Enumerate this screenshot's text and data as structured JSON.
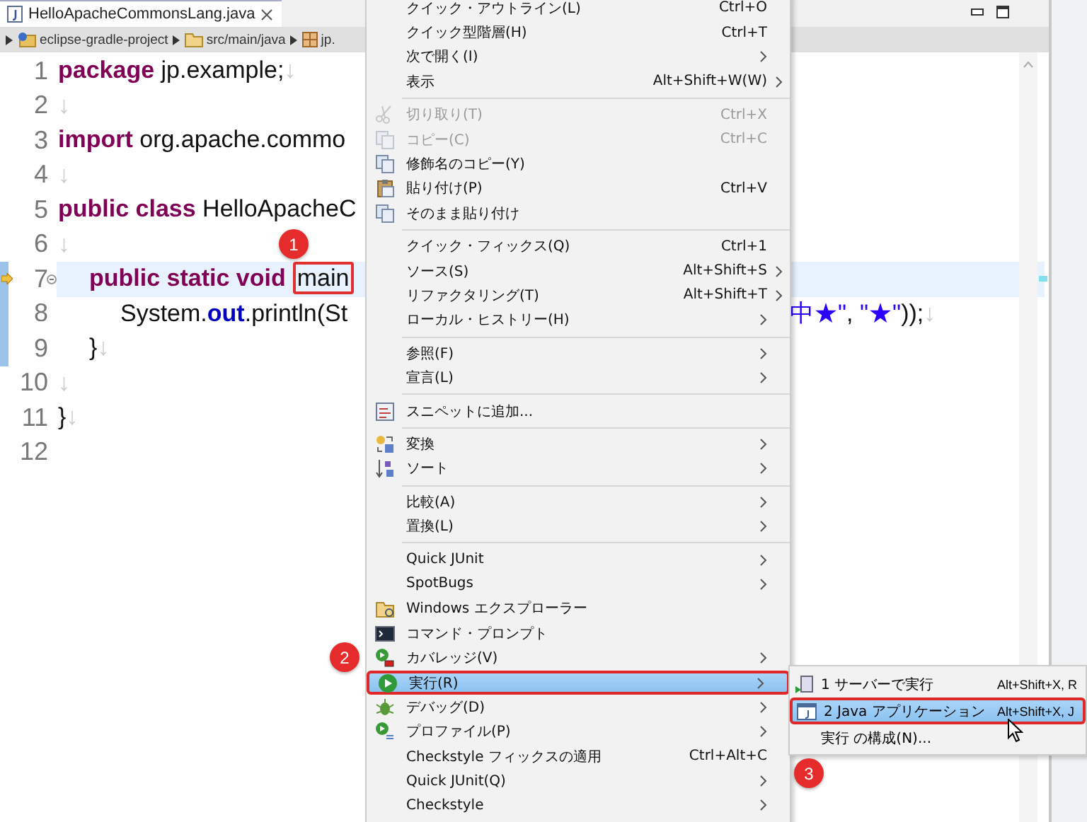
{
  "editor": {
    "tab": {
      "title": "HelloApacheCommonsLang.java",
      "selected": true
    },
    "breadcrumb": [
      "eclipse-gradle-project",
      "src/main/java",
      "jp."
    ],
    "lines": [
      {
        "number": "1",
        "changed": false,
        "current": false,
        "foldable": false,
        "segments": [
          {
            "kind": "keyword",
            "text": "package"
          },
          {
            "kind": "plain",
            "text": " jp.example;"
          },
          {
            "kind": "eol",
            "text": "↓"
          }
        ]
      },
      {
        "number": "2",
        "changed": false,
        "current": false,
        "foldable": false,
        "segments": [
          {
            "kind": "eol",
            "text": "↓"
          }
        ]
      },
      {
        "number": "3",
        "changed": false,
        "current": false,
        "foldable": false,
        "segments": [
          {
            "kind": "keyword",
            "text": "import"
          },
          {
            "kind": "plain",
            "text": " org.apache.commo"
          }
        ]
      },
      {
        "number": "4",
        "changed": false,
        "current": false,
        "foldable": false,
        "segments": [
          {
            "kind": "eol",
            "text": "↓"
          }
        ]
      },
      {
        "number": "5",
        "changed": false,
        "current": false,
        "foldable": false,
        "segments": [
          {
            "kind": "keyword",
            "text": "public class"
          },
          {
            "kind": "plain",
            "text": " HelloApacheC"
          }
        ]
      },
      {
        "number": "6",
        "changed": false,
        "current": false,
        "foldable": false,
        "segments": [
          {
            "kind": "eol",
            "text": "↓"
          }
        ]
      },
      {
        "number": "7",
        "changed": true,
        "current": true,
        "foldable": true,
        "segments": [
          {
            "kind": "keyword",
            "text": "\tpublic static void"
          },
          {
            "kind": "boxed",
            "text": "main"
          }
        ]
      },
      {
        "number": "8",
        "changed": true,
        "current": false,
        "foldable": false,
        "segments": [
          {
            "kind": "plain",
            "text": "\t\tSystem."
          },
          {
            "kind": "field",
            "text": "out"
          },
          {
            "kind": "plain",
            "text": ".println(St"
          }
        ],
        "tail": [
          {
            "kind": "string",
            "text": "中★\""
          },
          {
            "kind": "plain",
            "text": ", "
          },
          {
            "kind": "string",
            "text": "\"★\""
          },
          {
            "kind": "plain",
            "text": "));"
          },
          {
            "kind": "eol",
            "text": "↓"
          }
        ]
      },
      {
        "number": "9",
        "changed": true,
        "current": false,
        "foldable": false,
        "segments": [
          {
            "kind": "plain",
            "text": "\t}"
          },
          {
            "kind": "eol",
            "text": "↓"
          }
        ]
      },
      {
        "number": "10",
        "changed": false,
        "current": false,
        "foldable": false,
        "segments": [
          {
            "kind": "eol",
            "text": "↓"
          }
        ]
      },
      {
        "number": "11",
        "changed": false,
        "current": false,
        "foldable": false,
        "segments": [
          {
            "kind": "plain",
            "text": "}"
          },
          {
            "kind": "eol",
            "text": "↓"
          }
        ]
      },
      {
        "number": "12",
        "changed": false,
        "current": false,
        "foldable": false
      }
    ]
  },
  "context_menu": {
    "items": [
      {
        "kind": "item",
        "label": "クイック・アウトライン(L)",
        "shortcut": "Ctrl+O",
        "submenu": false,
        "disabled": false,
        "selected": false
      },
      {
        "kind": "item",
        "label": "クイック型階層(H)",
        "shortcut": "Ctrl+T",
        "submenu": false,
        "disabled": false,
        "selected": false
      },
      {
        "kind": "item",
        "label": "次で開く(I)",
        "submenu": true,
        "disabled": false,
        "selected": false
      },
      {
        "kind": "item",
        "label": "表示",
        "shortcut": "Alt+Shift+W(W)",
        "submenu": true,
        "disabled": false,
        "selected": false
      },
      {
        "kind": "separator"
      },
      {
        "kind": "item",
        "label": "切り取り(T)",
        "shortcut": "Ctrl+X",
        "submenu": false,
        "disabled": true,
        "selected": false
      },
      {
        "kind": "item",
        "label": "コピー(C)",
        "shortcut": "Ctrl+C",
        "submenu": false,
        "disabled": true,
        "selected": false
      },
      {
        "kind": "item",
        "label": "修飾名のコピー(Y)",
        "submenu": false,
        "disabled": false,
        "selected": false
      },
      {
        "kind": "item",
        "label": "貼り付け(P)",
        "shortcut": "Ctrl+V",
        "submenu": false,
        "disabled": false,
        "selected": false
      },
      {
        "kind": "item",
        "label": "そのまま貼り付け",
        "submenu": false,
        "disabled": false,
        "selected": false
      },
      {
        "kind": "separator"
      },
      {
        "kind": "item",
        "label": "クイック・フィックス(Q)",
        "shortcut": "Ctrl+1",
        "submenu": false,
        "disabled": false,
        "selected": false
      },
      {
        "kind": "item",
        "label": "ソース(S)",
        "shortcut": "Alt+Shift+S",
        "submenu": true,
        "disabled": false,
        "selected": false
      },
      {
        "kind": "item",
        "label": "リファクタリング(T)",
        "shortcut": "Alt+Shift+T",
        "submenu": true,
        "disabled": false,
        "selected": false
      },
      {
        "kind": "item",
        "label": "ローカル・ヒストリー(H)",
        "submenu": true,
        "disabled": false,
        "selected": false
      },
      {
        "kind": "separator"
      },
      {
        "kind": "item",
        "label": "参照(F)",
        "submenu": true,
        "disabled": false,
        "selected": false
      },
      {
        "kind": "item",
        "label": "宣言(L)",
        "submenu": true,
        "disabled": false,
        "selected": false
      },
      {
        "kind": "separator"
      },
      {
        "kind": "item",
        "label": "スニペットに追加...",
        "submenu": false,
        "disabled": false,
        "selected": false
      },
      {
        "kind": "separator"
      },
      {
        "kind": "item",
        "label": "変換",
        "submenu": true,
        "disabled": false,
        "selected": false
      },
      {
        "kind": "item",
        "label": "ソート",
        "submenu": true,
        "disabled": false,
        "selected": false
      },
      {
        "kind": "separator"
      },
      {
        "kind": "item",
        "label": "比較(A)",
        "submenu": true,
        "disabled": false,
        "selected": false
      },
      {
        "kind": "item",
        "label": "置換(L)",
        "submenu": true,
        "disabled": false,
        "selected": false
      },
      {
        "kind": "separator"
      },
      {
        "kind": "item",
        "label": "Quick JUnit",
        "submenu": true,
        "disabled": false,
        "selected": false
      },
      {
        "kind": "item",
        "label": "SpotBugs",
        "submenu": true,
        "disabled": false,
        "selected": false
      },
      {
        "kind": "item",
        "label": "Windows エクスプローラー",
        "submenu": false,
        "disabled": false,
        "selected": false
      },
      {
        "kind": "item",
        "label": "コマンド・プロンプト",
        "submenu": false,
        "disabled": false,
        "selected": false
      },
      {
        "kind": "item",
        "label": "カバレッジ(V)",
        "submenu": true,
        "disabled": false,
        "selected": false
      },
      {
        "kind": "item",
        "label": "実行(R)",
        "submenu": true,
        "disabled": false,
        "selected": true
      },
      {
        "kind": "item",
        "label": "デバッグ(D)",
        "submenu": true,
        "disabled": false,
        "selected": false
      },
      {
        "kind": "item",
        "label": "プロファイル(P)",
        "submenu": true,
        "disabled": false,
        "selected": false
      },
      {
        "kind": "item",
        "label": "Checkstyle フィックスの適用",
        "shortcut": "Ctrl+Alt+C",
        "submenu": false,
        "disabled": false,
        "selected": false
      },
      {
        "kind": "item",
        "label": "Quick JUnit(Q)",
        "submenu": true,
        "disabled": false,
        "selected": false
      },
      {
        "kind": "item",
        "label": "Checkstyle",
        "submenu": true,
        "disabled": false,
        "selected": false
      }
    ]
  },
  "submenu": {
    "items": [
      {
        "label": "1 サーバーで実行",
        "shortcut": "Alt+Shift+X, R",
        "selected": false
      },
      {
        "label": "2 Java アプリケーション",
        "shortcut": "Alt+Shift+X, J",
        "selected": true
      },
      {
        "label": "実行 の構成(N)...",
        "selected": false
      }
    ]
  },
  "callouts": [
    "1",
    "2",
    "3"
  ]
}
